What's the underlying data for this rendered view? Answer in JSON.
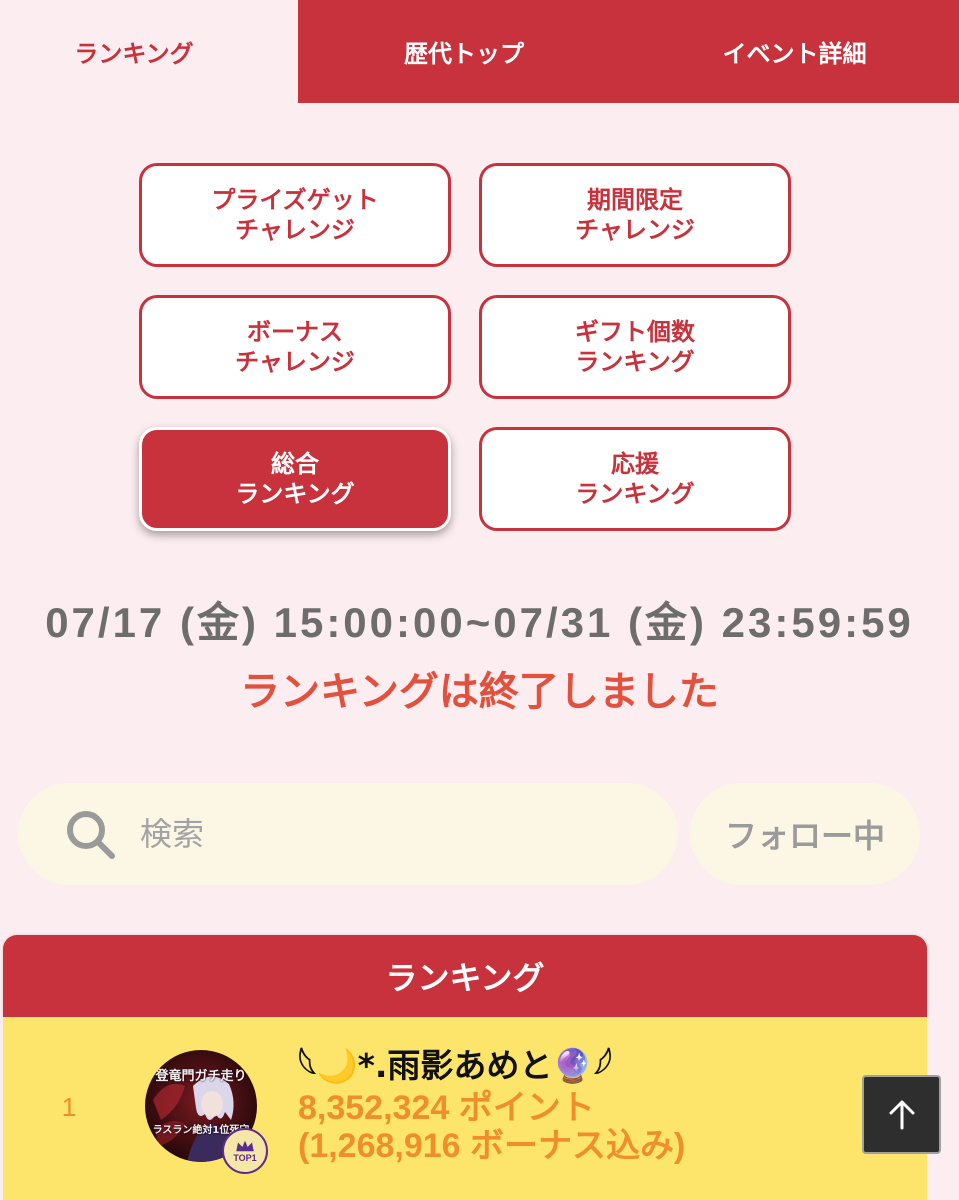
{
  "colors": {
    "accent": "#c8323c",
    "page_background": "#fcedf0",
    "status_text": "#e2503e",
    "points_text": "#ee8f2c",
    "row_highlight": "#fde46b",
    "pill_background": "#fbf7e4"
  },
  "tabs": [
    {
      "label": "ランキング",
      "active": true
    },
    {
      "label": "歴代トップ",
      "active": false
    },
    {
      "label": "イベント詳細",
      "active": false
    }
  ],
  "category_buttons": [
    {
      "line1": "プライズゲット",
      "line2": "チャレンジ",
      "active": false
    },
    {
      "line1": "期間限定",
      "line2": "チャレンジ",
      "active": false
    },
    {
      "line1": "ボーナス",
      "line2": "チャレンジ",
      "active": false
    },
    {
      "line1": "ギフト個数",
      "line2": "ランキング",
      "active": false
    },
    {
      "line1": "総合",
      "line2": "ランキング",
      "active": true
    },
    {
      "line1": "応援",
      "line2": "ランキング",
      "active": false
    }
  ],
  "event": {
    "period": "07/17 (金) 15:00:00~07/31 (金) 23:59:59",
    "status": "ランキングは終了しました"
  },
  "search": {
    "icon": "search-icon",
    "placeholder": "検索",
    "value": ""
  },
  "follow_filter": {
    "label": "フォロー中"
  },
  "ranking": {
    "title": "ランキング",
    "entries": [
      {
        "rank": "1",
        "name": "𓆩🌙*.雨影あめと🔮𓆪",
        "points": "8,352,324 ポイント",
        "bonus": "(1,268,916 ボーナス込み)",
        "avatar": {
          "top_text": "登竜門ガチ走り",
          "bottom_text": "ラスラン絶対1位死守"
        },
        "badge": {
          "icon": "crown-icon",
          "label": "TOP1"
        }
      }
    ]
  },
  "scroll_top_button": {
    "icon": "arrow-up-icon"
  }
}
